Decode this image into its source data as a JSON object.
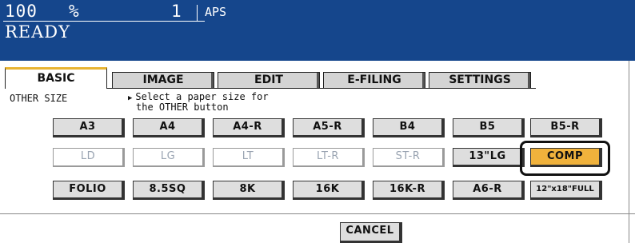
{
  "status": {
    "zoom": "100",
    "percent_sign": "%",
    "copies": "1",
    "mode": "APS",
    "state": "READY"
  },
  "tabs": [
    "BASIC",
    "IMAGE",
    "EDIT",
    "E-FILING",
    "SETTINGS"
  ],
  "active_tab": "BASIC",
  "section_title": "OTHER SIZE",
  "instruction": {
    "line1": "Select a paper size for",
    "line2": "the OTHER button"
  },
  "paper_rows": [
    [
      {
        "label": "A3",
        "state": "normal"
      },
      {
        "label": "A4",
        "state": "normal"
      },
      {
        "label": "A4-R",
        "state": "normal"
      },
      {
        "label": "A5-R",
        "state": "normal"
      },
      {
        "label": "B4",
        "state": "normal"
      },
      {
        "label": "B5",
        "state": "normal"
      },
      {
        "label": "B5-R",
        "state": "normal"
      }
    ],
    [
      {
        "label": "LD",
        "state": "disabled"
      },
      {
        "label": "LG",
        "state": "disabled"
      },
      {
        "label": "LT",
        "state": "disabled"
      },
      {
        "label": "LT-R",
        "state": "disabled"
      },
      {
        "label": "ST-R",
        "state": "disabled"
      },
      {
        "label": "13\"LG",
        "state": "normal"
      },
      {
        "label": "COMP",
        "state": "selected"
      }
    ],
    [
      {
        "label": "FOLIO",
        "state": "normal"
      },
      {
        "label": "8.5SQ",
        "state": "normal"
      },
      {
        "label": "8K",
        "state": "normal"
      },
      {
        "label": "16K",
        "state": "normal"
      },
      {
        "label": "16K-R",
        "state": "normal"
      },
      {
        "label": "A6-R",
        "state": "normal"
      },
      {
        "label": "12\"x18\"FULL",
        "state": "normal"
      }
    ]
  ],
  "cancel_label": "CANCEL",
  "colors": {
    "header_bg": "#15468c",
    "selected_bg": "#f0b23c",
    "active_tab_accent": "#e8b432",
    "disabled_text": "#9aa4b2"
  }
}
